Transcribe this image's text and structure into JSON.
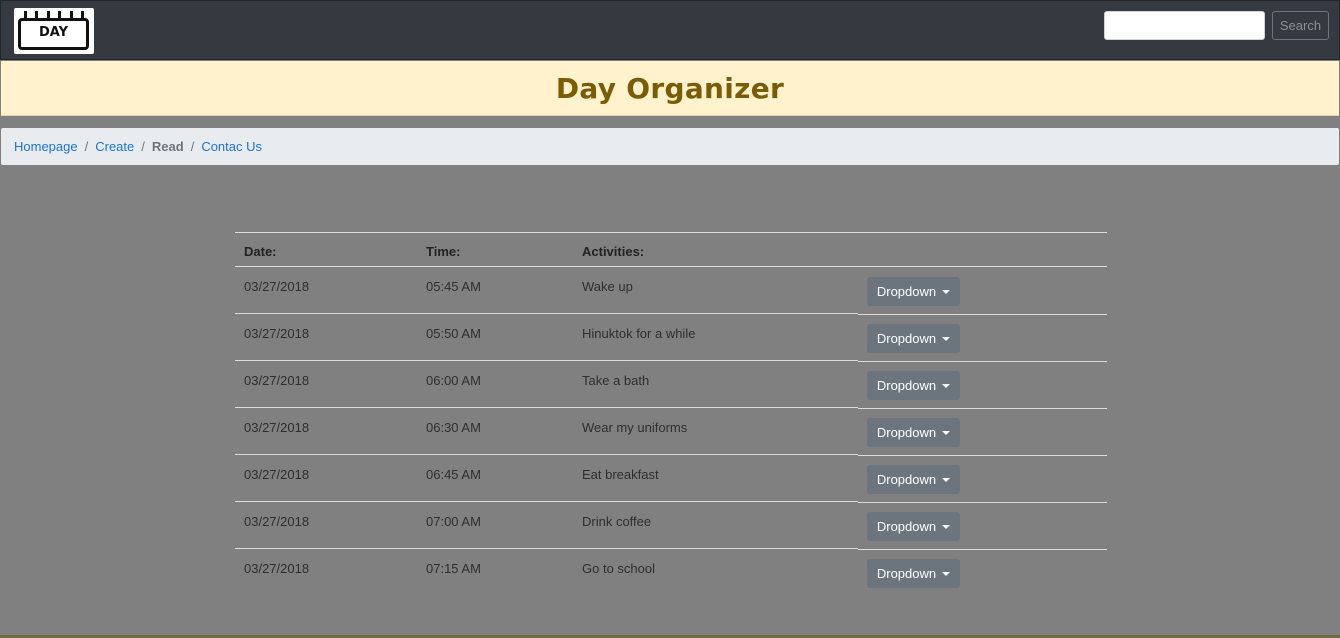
{
  "navbar": {
    "logo_text": "DAY",
    "search_placeholder": "",
    "search_button": "Search"
  },
  "banner": {
    "title": "Day Organizer"
  },
  "breadcrumb": {
    "items": [
      "Homepage",
      "Create",
      "Read",
      "Contac Us"
    ],
    "separator": "/"
  },
  "table": {
    "headers": {
      "date": "Date:",
      "time": "Time:",
      "activities": "Activities:"
    },
    "rows": [
      {
        "date": "03/27/2018",
        "time": "05:45 AM",
        "activity": "Wake up",
        "action": "Dropdown"
      },
      {
        "date": "03/27/2018",
        "time": "05:50 AM",
        "activity": "Hinuktok for a while",
        "action": "Dropdown"
      },
      {
        "date": "03/27/2018",
        "time": "06:00 AM",
        "activity": "Take a bath",
        "action": "Dropdown"
      },
      {
        "date": "03/27/2018",
        "time": "06:30 AM",
        "activity": "Wear my uniforms",
        "action": "Dropdown"
      },
      {
        "date": "03/27/2018",
        "time": "06:45 AM",
        "activity": "Eat breakfast",
        "action": "Dropdown"
      },
      {
        "date": "03/27/2018",
        "time": "07:00 AM",
        "activity": "Drink coffee",
        "action": "Dropdown"
      },
      {
        "date": "03/27/2018",
        "time": "07:15 AM",
        "activity": "Go to school",
        "action": "Dropdown"
      }
    ]
  },
  "colors": {
    "navbar": "#343a40",
    "banner_bg": "#fff2cc",
    "banner_title": "#7a5c07",
    "page_bg": "#808080",
    "link": "#1a73d6",
    "dropdown_button": "#6c757d"
  }
}
